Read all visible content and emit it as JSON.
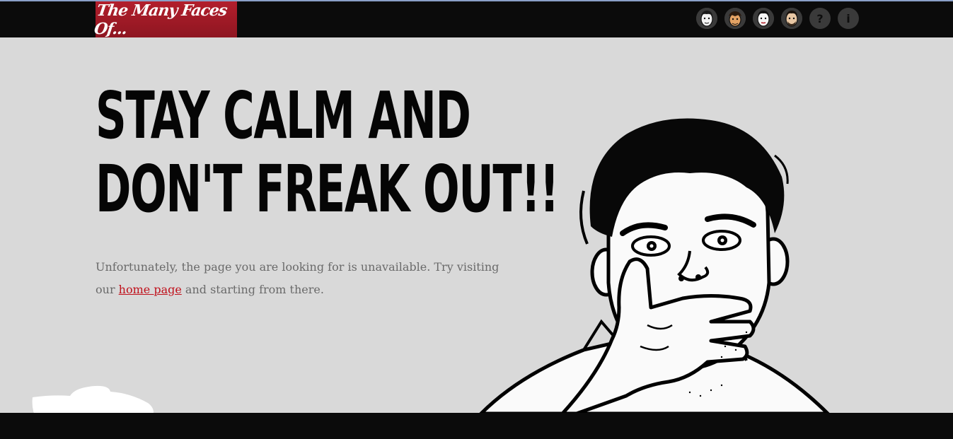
{
  "header": {
    "logo_text": "The Many Faces Of...",
    "nav": [
      {
        "icon": "face-1-icon"
      },
      {
        "icon": "face-2-icon"
      },
      {
        "icon": "face-3-icon"
      },
      {
        "icon": "face-4-icon"
      },
      {
        "icon": "help-icon",
        "glyph": "?"
      },
      {
        "icon": "info-icon",
        "glyph": "i"
      }
    ]
  },
  "main": {
    "headline_line1": "STAY CALM AND",
    "headline_line2": "DON'T FREAK OUT!!",
    "message_before": "Unfortunately, the page you are looking for is unavailable. Try visiting our ",
    "home_link": "home page",
    "message_after": " and starting from there."
  },
  "colors": {
    "header_bg": "#0b0b0b",
    "logo_red": "#a01a26",
    "page_bg": "#d9d9d9",
    "link": "#c0111c"
  }
}
